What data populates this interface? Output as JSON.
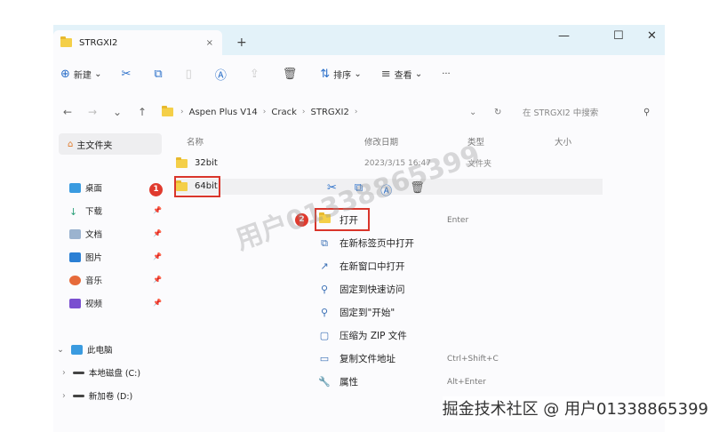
{
  "window": {
    "tab_title": "STRGXI2",
    "close_tab": "×",
    "new_tab": "+",
    "minimize": "—",
    "maximize": "☐",
    "close": "✕"
  },
  "toolbar": {
    "new_label": "新建",
    "sort_label": "排序",
    "view_label": "查看",
    "more": "···"
  },
  "address": {
    "crumbs": [
      "Aspen Plus V14",
      "Crack",
      "STRGXI2"
    ],
    "search_placeholder": "在 STRGXI2 中搜索"
  },
  "sidebar": {
    "home": "主文件夹",
    "items": [
      {
        "label": "桌面"
      },
      {
        "label": "下载"
      },
      {
        "label": "文档"
      },
      {
        "label": "图片"
      },
      {
        "label": "音乐"
      },
      {
        "label": "视频"
      }
    ],
    "this_pc": "此电脑",
    "drives": [
      "本地磁盘 (C:)",
      "新加卷 (D:)"
    ]
  },
  "columns": {
    "name": "名称",
    "modified": "修改日期",
    "type": "类型",
    "size": "大小"
  },
  "files": [
    {
      "name": "32bit",
      "modified": "2023/3/15 16:47",
      "type": "文件夹"
    },
    {
      "name": "64bit"
    }
  ],
  "context_menu": {
    "items": [
      {
        "label": "打开",
        "shortcut": "Enter"
      },
      {
        "label": "在新标签页中打开"
      },
      {
        "label": "在新窗口中打开"
      },
      {
        "label": "固定到快速访问"
      },
      {
        "label": "固定到\"开始\""
      },
      {
        "label": "压缩为 ZIP 文件"
      },
      {
        "label": "复制文件地址",
        "shortcut": "Ctrl+Shift+C"
      },
      {
        "label": "属性",
        "shortcut": "Alt+Enter"
      }
    ]
  },
  "annotations": {
    "step1": "1",
    "step2": "2"
  },
  "watermark": "用户01338865399",
  "credit": "掘金技术社区 @ 用户01338865399"
}
